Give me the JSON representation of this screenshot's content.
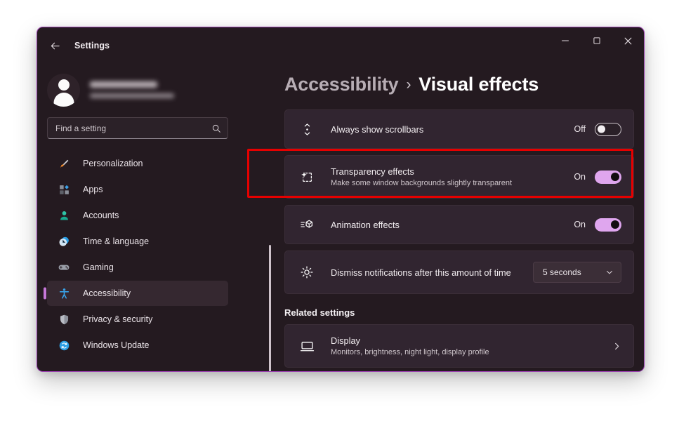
{
  "window": {
    "titlebar": {
      "back_label": "back-arrow",
      "title": "Settings",
      "minimize_label": "Minimize",
      "maximize_label": "Maximize",
      "close_label": "Close"
    },
    "accent_border_color": "#9a3fb0",
    "background_color": "#241a20"
  },
  "sidebar": {
    "profile": {
      "name": "",
      "email": "",
      "redacted": true,
      "avatar_icon": "person-avatar-icon"
    },
    "search": {
      "placeholder": "Find a setting",
      "value": "",
      "icon": "search-icon"
    },
    "items": [
      {
        "label": "Personalization",
        "icon": "paintbrush-icon",
        "selected": false
      },
      {
        "label": "Apps",
        "icon": "apps-grid-icon",
        "selected": false
      },
      {
        "label": "Accounts",
        "icon": "person-icon",
        "selected": false
      },
      {
        "label": "Time & language",
        "icon": "clock-icon",
        "selected": false
      },
      {
        "label": "Gaming",
        "icon": "gamepad-icon",
        "selected": false
      },
      {
        "label": "Accessibility",
        "icon": "accessibility-icon",
        "selected": true
      },
      {
        "label": "Privacy & security",
        "icon": "shield-icon",
        "selected": false
      },
      {
        "label": "Windows Update",
        "icon": "update-refresh-icon",
        "selected": false
      }
    ],
    "selection_indicator_color": "#c678d8"
  },
  "content": {
    "breadcrumb": {
      "parent": "Accessibility",
      "separator": "›",
      "current": "Visual effects"
    },
    "settings": [
      {
        "title": "Always show scrollbars",
        "subtitle": "",
        "icon": "scrollbar-icon",
        "control": "toggle",
        "state": "Off",
        "on": false
      },
      {
        "title": "Transparency effects",
        "subtitle": "Make some window backgrounds slightly transparent",
        "icon": "sparkle-transparency-icon",
        "control": "toggle",
        "state": "On",
        "on": true,
        "highlighted": true
      },
      {
        "title": "Animation effects",
        "subtitle": "",
        "icon": "animation-motion-icon",
        "control": "toggle",
        "state": "On",
        "on": true
      },
      {
        "title": "Dismiss notifications after this amount of time",
        "subtitle": "",
        "icon": "notification-timer-icon",
        "control": "dropdown",
        "value": "5 seconds",
        "chevron": "chevron-down-icon"
      }
    ],
    "related": {
      "heading": "Related settings",
      "items": [
        {
          "title": "Display",
          "subtitle": "Monitors, brightness, night light, display profile",
          "icon": "monitor-icon",
          "chevron": "chevron-right-icon"
        }
      ]
    },
    "toggle_on_color": "#dfa6ee",
    "scrollbar": "content-scrollbar"
  },
  "annotation": {
    "type": "rectangle-highlight",
    "color": "#e60000",
    "targets": "Transparency effects"
  }
}
